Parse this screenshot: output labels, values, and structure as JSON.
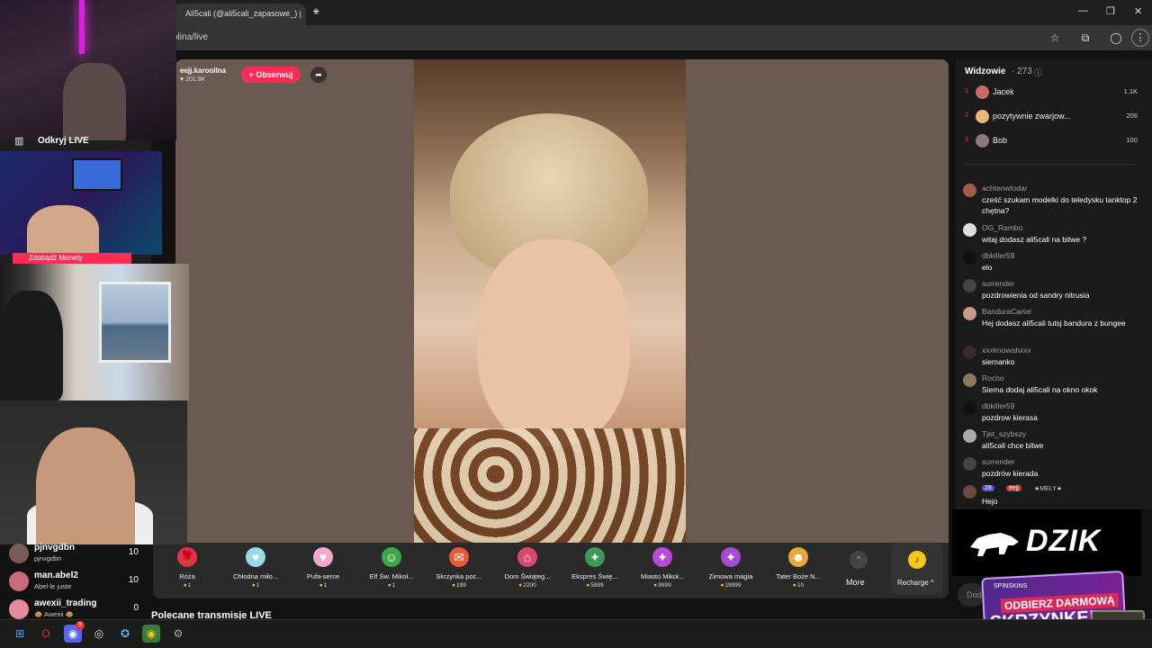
{
  "browser": {
    "tab_title": "Ali5cali (@ali5cali_zapasowe_) j",
    "tab_close": "×",
    "new_tab": "+",
    "url": "olina/live",
    "window_controls": [
      "—",
      "❐",
      "✕"
    ],
    "address_icons": [
      "star-icon",
      "extensions-icon",
      "profile-icon"
    ],
    "menu": "⋮"
  },
  "stream": {
    "streamer": "eejj.karoollna",
    "likes": "201.8K",
    "follow_label": "+ Obserwuj",
    "share_icon": "share-icon"
  },
  "gifts": [
    {
      "name": "Róża",
      "price": "1",
      "color": "#e8304a",
      "glyph": "🌹"
    },
    {
      "name": "Chłodna miło...",
      "price": "1",
      "color": "#9ad8e8",
      "glyph": "♥"
    },
    {
      "name": "Pufa-serce",
      "price": "1",
      "color": "#f4a8d0",
      "glyph": "♥"
    },
    {
      "name": "Elf Św. Mikoł...",
      "price": "1",
      "color": "#3aa84a",
      "glyph": "☺"
    },
    {
      "name": "Skrzynka poc...",
      "price": "199",
      "color": "#e85a3a",
      "glyph": "✉"
    },
    {
      "name": "Dom Świąteg...",
      "price": "2200",
      "color": "#d84a6a",
      "glyph": "⌂"
    },
    {
      "name": "Ekspres Świę...",
      "price": "5999",
      "color": "#3a9a5a",
      "glyph": "✦"
    },
    {
      "name": "Miasto Mikoł...",
      "price": "9999",
      "color": "#b84ad8",
      "glyph": "✦"
    },
    {
      "name": "Zimowa magia",
      "price": "19999",
      "color": "#a84ad8",
      "glyph": "✦"
    },
    {
      "name": "Tater Boże N...",
      "price": "10",
      "color": "#e8a83a",
      "glyph": "☻"
    }
  ],
  "gift_more": "More",
  "recharge": "Recharge ^",
  "recommended": "Polecane transmisje LIVE",
  "viewers": {
    "title": "Widzowie",
    "count": "· 273",
    "top": [
      {
        "rank": "1",
        "name": "Jacek",
        "score": "1.1K",
        "color": "#c86a6a"
      },
      {
        "rank": "2",
        "name": "pozytywnie zwarjow...",
        "score": "206",
        "color": "#e8b87a"
      },
      {
        "rank": "3",
        "name": "Bob",
        "score": "100",
        "color": "#8a7a7a"
      }
    ]
  },
  "chat": [
    {
      "user": "achtenwlodar",
      "msg": "cześć szukam modelki do teledysku tanktop 2 chętna?",
      "color": "#a85a4a"
    },
    {
      "user": "OG_Rambo",
      "msg": "witaj dodasz ali5cali na bitwe ?",
      "color": "#dddddd"
    },
    {
      "user": "dbkiller59",
      "msg": "elo",
      "color": "#111111"
    },
    {
      "user": "surrender",
      "msg": "pozdrowienia od sandry nitrusia",
      "color": "#444444"
    },
    {
      "user": "BanduraCartel",
      "msg": "Hej dodasz ali5cali tutsj bandura z bungee",
      "color": "#c89a8a"
    },
    {
      "user": "xxxknowahxxx",
      "msg": "siemanko",
      "color": "#3a2a2a"
    },
    {
      "user": "Rocho",
      "msg": "Siema dodaj ali5cali na okno okok",
      "color": "#8a7a5a"
    },
    {
      "user": "dbkiller59",
      "msg": "pozdrow kierasa",
      "color": "#111111"
    },
    {
      "user": "Tjet_szybszy",
      "msg": "ali5cali chce bitwe",
      "color": "#aaaaaa"
    },
    {
      "user": "surrender",
      "msg": "pozdrów kierada",
      "color": "#444444"
    },
    {
      "user": "",
      "msg": "Hejo",
      "color": "#6a4a3a",
      "badge1": "28",
      "badge2": "eejj",
      "extra": "★MELY★"
    }
  ],
  "chat_placeholder": "Dod",
  "dzik": {
    "brand": "DZIK",
    "promo_small": "SPINSKINS",
    "promo_line1": "ODBIERZ DARMOWĄ",
    "promo_line2": "SKRZYNKĘ!"
  },
  "overlay": {
    "cam1_label": "Odkryj LIVE",
    "cam2_label": "Zdobądź Monety"
  },
  "left_list": [
    {
      "name": "pjnvgdbn",
      "sub": "pjnvgdbn",
      "count": "10",
      "color": "#7a5a5a"
    },
    {
      "name": "man.abel2",
      "sub": "Abel-le juste",
      "count": "10",
      "color": "#c86a7a"
    },
    {
      "name": "awexii_trading",
      "sub": "🐵 Awexii 🐵",
      "count": "0",
      "color": "#e88a9a"
    }
  ],
  "taskbar": {
    "icons": [
      "windows-start-icon",
      "opera-icon",
      "discord-icon",
      "obs-icon",
      "steam-icon",
      "chrome-icon",
      "settings-icon"
    ],
    "discord_badge": "9"
  }
}
